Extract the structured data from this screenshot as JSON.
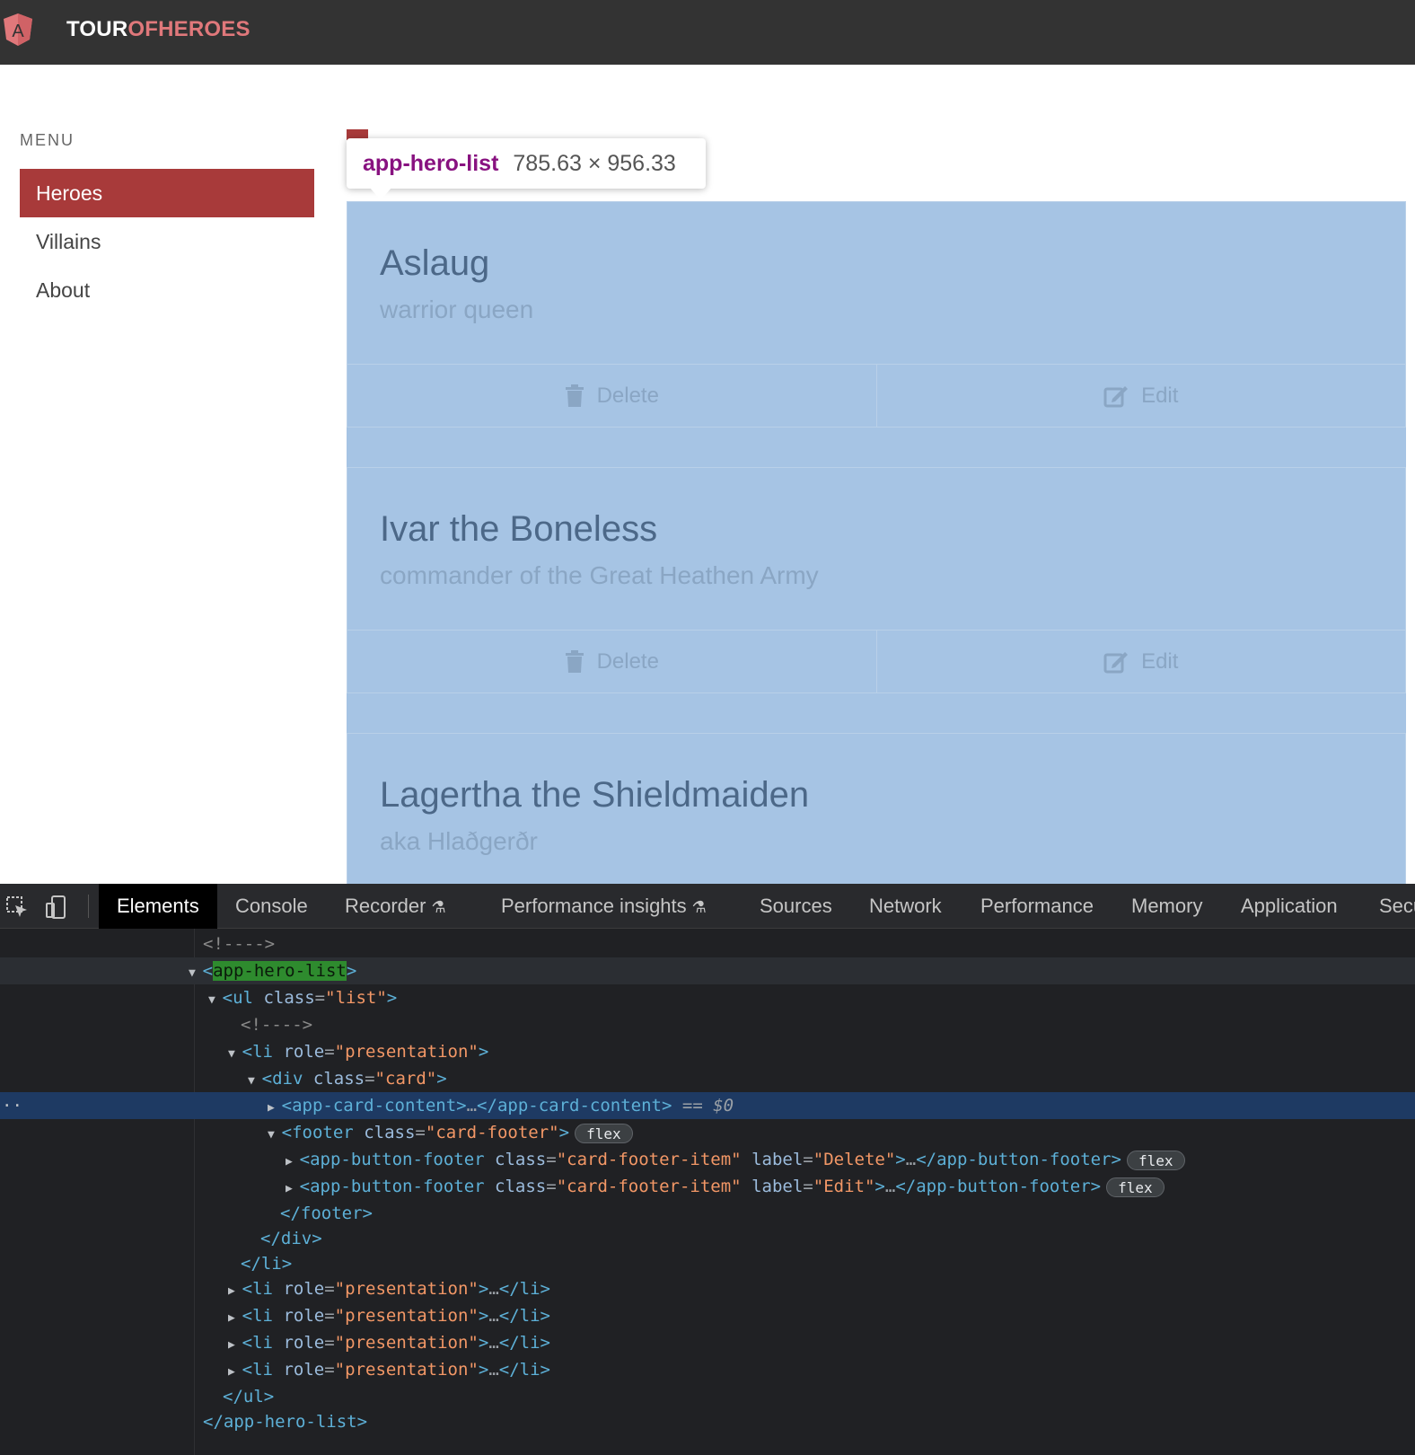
{
  "app": {
    "brand_part1": "TOUR",
    "brand_part2": "OF",
    "brand_part3": "HEROES",
    "logo_letter": "A",
    "accent_color": "#a83a3a"
  },
  "sidebar": {
    "title": "MENU",
    "items": [
      {
        "label": "Heroes",
        "active": true
      },
      {
        "label": "Villains",
        "active": false
      },
      {
        "label": "About",
        "active": false
      }
    ]
  },
  "inspect_tooltip": {
    "tag": "app-hero-list",
    "dimensions": "785.63 × 956.33"
  },
  "heroes": [
    {
      "name": "Aslaug",
      "description": "warrior queen"
    },
    {
      "name": "Ivar the Boneless",
      "description": "commander of the Great Heathen Army"
    },
    {
      "name": "Lagertha the Shieldmaiden",
      "description": "aka Hlaðgerðr"
    }
  ],
  "card_actions": {
    "delete": "Delete",
    "edit": "Edit"
  },
  "devtools": {
    "tabs": [
      {
        "label": "Elements",
        "active": true
      },
      {
        "label": "Console",
        "active": false
      },
      {
        "label": "Recorder",
        "active": false,
        "experimental": true
      },
      {
        "label": "Performance insights",
        "active": false,
        "experimental": true
      },
      {
        "label": "Sources",
        "active": false
      },
      {
        "label": "Network",
        "active": false
      },
      {
        "label": "Performance",
        "active": false
      },
      {
        "label": "Memory",
        "active": false
      },
      {
        "label": "Application",
        "active": false
      },
      {
        "label": "Secu",
        "active": false
      }
    ],
    "dom": {
      "comment": "<!---->",
      "hero_list_tag": "app-hero-list",
      "ul_tag": "ul",
      "class_attr": "class",
      "list_class": "list",
      "li_tag": "li",
      "role_attr": "role",
      "role_value": "presentation",
      "div_tag": "div",
      "card_class": "card",
      "card_content_tag": "app-card-content",
      "selected_marker": "== $0",
      "footer_tag": "footer",
      "footer_class": "card-footer",
      "flex_badge": "flex",
      "button_footer_tag": "app-button-footer",
      "footer_item_class": "card-footer-item",
      "label_attr": "label",
      "delete_label": "Delete",
      "edit_label": "Edit"
    }
  }
}
